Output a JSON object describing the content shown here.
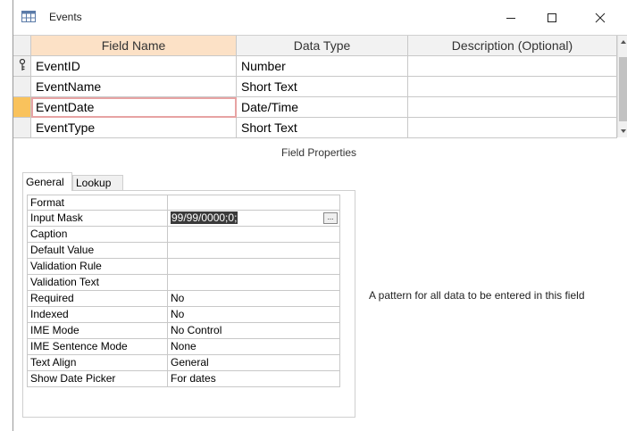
{
  "window": {
    "title": "Events",
    "controls": {
      "minimize": "minimize-icon",
      "maximize": "maximize-icon",
      "close": "close-icon"
    }
  },
  "grid": {
    "headers": {
      "field_name": "Field Name",
      "data_type": "Data Type",
      "description": "Description (Optional)"
    },
    "rows": [
      {
        "field_name": "EventID",
        "data_type": "Number",
        "description": "",
        "primary_key": true
      },
      {
        "field_name": "EventName",
        "data_type": "Short Text",
        "description": ""
      },
      {
        "field_name": "EventDate",
        "data_type": "Date/Time",
        "description": "",
        "current": true
      },
      {
        "field_name": "EventType",
        "data_type": "Short Text",
        "description": ""
      }
    ]
  },
  "field_properties": {
    "section_label": "Field Properties",
    "tabs": [
      "General",
      "Lookup"
    ],
    "active_tab": "General",
    "properties": [
      {
        "label": "Format",
        "value": ""
      },
      {
        "label": "Input Mask",
        "value": "99/99/0000;0;"
      },
      {
        "label": "Caption",
        "value": ""
      },
      {
        "label": "Default Value",
        "value": ""
      },
      {
        "label": "Validation Rule",
        "value": ""
      },
      {
        "label": "Validation Text",
        "value": ""
      },
      {
        "label": "Required",
        "value": "No"
      },
      {
        "label": "Indexed",
        "value": "No"
      },
      {
        "label": "IME Mode",
        "value": "No Control"
      },
      {
        "label": "IME Sentence Mode",
        "value": "None"
      },
      {
        "label": "Text Align",
        "value": "General"
      },
      {
        "label": "Show Date Picker",
        "value": "For dates"
      }
    ],
    "build_button_label": "...",
    "hint": "A pattern for all data to be entered in this field"
  }
}
